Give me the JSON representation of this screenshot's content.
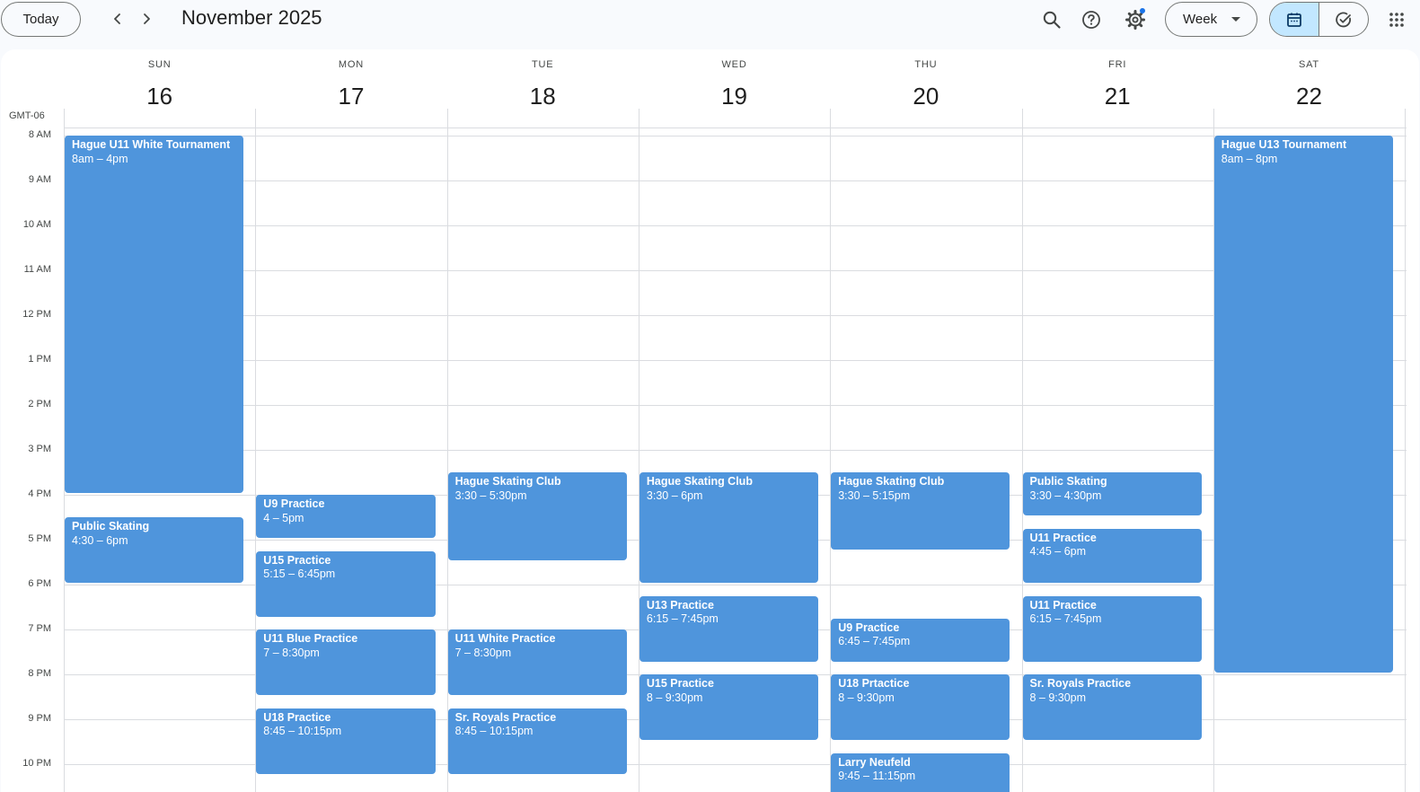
{
  "toolbar": {
    "today_label": "Today",
    "month_title": "November 2025",
    "view_label": "Week",
    "prev_icon": "chevron-left-icon",
    "next_icon": "chevron-right-icon",
    "search_icon": "search-icon",
    "help_icon": "help-icon",
    "settings_icon": "gear-icon",
    "calendar_icon": "calendar-icon",
    "tasks_icon": "check-circle-icon",
    "apps_icon": "apps-grid-icon"
  },
  "colors": {
    "event": "#4f95dc",
    "accent": "#1a73e8",
    "active_segment": "#c2e7ff"
  },
  "timezone_label": "GMT-06",
  "days": [
    {
      "dow": "SUN",
      "num": "16"
    },
    {
      "dow": "MON",
      "num": "17"
    },
    {
      "dow": "TUE",
      "num": "18"
    },
    {
      "dow": "WED",
      "num": "19"
    },
    {
      "dow": "THU",
      "num": "20"
    },
    {
      "dow": "FRI",
      "num": "21"
    },
    {
      "dow": "SAT",
      "num": "22"
    }
  ],
  "hours": [
    "8 AM",
    "9 AM",
    "10 AM",
    "11 AM",
    "12 PM",
    "1 PM",
    "2 PM",
    "3 PM",
    "4 PM",
    "5 PM",
    "6 PM",
    "7 PM",
    "8 PM",
    "9 PM",
    "10 PM"
  ],
  "events": [
    {
      "day": 0,
      "start": 8.0,
      "end": 16.0,
      "title": "Hague U11 White Tournament",
      "time": "8am – 4pm"
    },
    {
      "day": 0,
      "start": 16.5,
      "end": 18.0,
      "title": "Public Skating",
      "time": "4:30 – 6pm"
    },
    {
      "day": 1,
      "start": 16.0,
      "end": 17.0,
      "title": "U9 Practice",
      "time": "4 – 5pm"
    },
    {
      "day": 1,
      "start": 17.25,
      "end": 18.75,
      "title": "U15 Practice",
      "time": "5:15 – 6:45pm"
    },
    {
      "day": 1,
      "start": 19.0,
      "end": 20.5,
      "title": "U11 Blue Practice",
      "time": "7 – 8:30pm"
    },
    {
      "day": 1,
      "start": 20.75,
      "end": 22.25,
      "title": "U18 Practice",
      "time": "8:45 – 10:15pm"
    },
    {
      "day": 2,
      "start": 15.5,
      "end": 17.5,
      "title": "Hague Skating Club",
      "time": "3:30 – 5:30pm"
    },
    {
      "day": 2,
      "start": 19.0,
      "end": 20.5,
      "title": "U11 White Practice",
      "time": "7 – 8:30pm"
    },
    {
      "day": 2,
      "start": 20.75,
      "end": 22.25,
      "title": "Sr. Royals Practice",
      "time": "8:45 – 10:15pm"
    },
    {
      "day": 3,
      "start": 15.5,
      "end": 18.0,
      "title": "Hague Skating Club",
      "time": "3:30 – 6pm"
    },
    {
      "day": 3,
      "start": 18.25,
      "end": 19.75,
      "title": "U13 Practice",
      "time": "6:15 – 7:45pm"
    },
    {
      "day": 3,
      "start": 20.0,
      "end": 21.5,
      "title": "U15 Practice",
      "time": "8 – 9:30pm"
    },
    {
      "day": 4,
      "start": 15.5,
      "end": 17.25,
      "title": "Hague Skating Club",
      "time": "3:30 – 5:15pm"
    },
    {
      "day": 4,
      "start": 18.75,
      "end": 19.75,
      "title": "U9 Practice",
      "time": "6:45 – 7:45pm"
    },
    {
      "day": 4,
      "start": 20.0,
      "end": 21.5,
      "title": "U18 Prtactice",
      "time": "8 – 9:30pm"
    },
    {
      "day": 4,
      "start": 21.75,
      "end": 23.25,
      "title": "Larry Neufeld",
      "time": "9:45 – 11:15pm"
    },
    {
      "day": 5,
      "start": 15.5,
      "end": 16.5,
      "title": "Public Skating",
      "time": "3:30 – 4:30pm"
    },
    {
      "day": 5,
      "start": 16.75,
      "end": 18.0,
      "title": "U11 Practice",
      "time": "4:45 – 6pm"
    },
    {
      "day": 5,
      "start": 18.25,
      "end": 19.75,
      "title": "U11 Practice",
      "time": "6:15 – 7:45pm"
    },
    {
      "day": 5,
      "start": 20.0,
      "end": 21.5,
      "title": "Sr. Royals Practice",
      "time": "8 – 9:30pm"
    },
    {
      "day": 6,
      "start": 8.0,
      "end": 20.0,
      "title": "Hague U13 Tournament",
      "time": "8am – 8pm"
    }
  ]
}
